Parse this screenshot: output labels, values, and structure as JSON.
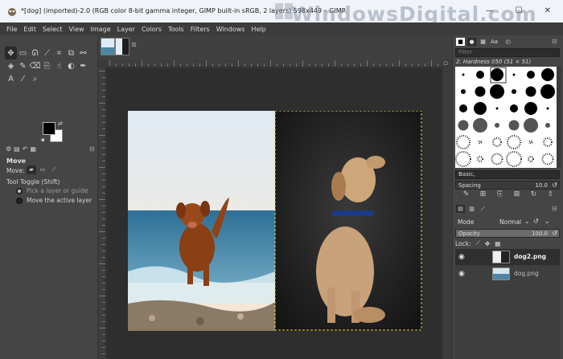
{
  "window": {
    "title": "*[dog] (imported)-2.0 (RGB color 8-bit gamma integer, GIMP built-in sRGB, 2 layers) 598x449 – GIMP",
    "watermark": "WindowsDigital.com",
    "controls": {
      "minimize": "—",
      "maximize": "☐",
      "close": "✕"
    }
  },
  "menu": [
    "File",
    "Edit",
    "Select",
    "View",
    "Image",
    "Layer",
    "Colors",
    "Tools",
    "Filters",
    "Windows",
    "Help"
  ],
  "toolbox": {
    "tools": [
      {
        "icon": "move-icon",
        "glyph": "✥"
      },
      {
        "icon": "rect-select-icon",
        "glyph": "▭"
      },
      {
        "icon": "lasso-icon",
        "glyph": "ᘏ"
      },
      {
        "icon": "fuzzy-select-icon",
        "glyph": "⟋"
      },
      {
        "icon": "crop-icon",
        "glyph": "⌗"
      },
      {
        "icon": "unified-transform-icon",
        "glyph": "⧉"
      },
      {
        "icon": "warp-icon",
        "glyph": "⚯"
      },
      {
        "icon": "bucket-fill-icon",
        "glyph": "◈"
      },
      {
        "icon": "paintbrush-icon",
        "glyph": "✎"
      },
      {
        "icon": "eraser-icon",
        "glyph": "⌫"
      },
      {
        "icon": "clone-icon",
        "glyph": "⎘"
      },
      {
        "icon": "smudge-icon",
        "glyph": "☝"
      },
      {
        "icon": "dodge-burn-icon",
        "glyph": "◐"
      },
      {
        "icon": "path-icon",
        "glyph": "✒"
      },
      {
        "icon": "text-tool-icon",
        "glyph": "A"
      },
      {
        "icon": "color-picker-icon",
        "glyph": "⁄"
      },
      {
        "icon": "zoom-icon",
        "glyph": "⌕"
      }
    ],
    "fg_color": "#000000",
    "bg_color": "#ffffff"
  },
  "tool_options": {
    "title": "Move",
    "move_label": "Move:",
    "toggle_label": "Tool Toggle  (Shift)",
    "option_pick": "Pick a layer or guide",
    "option_active": "Move the active layer"
  },
  "brushes": {
    "filter_placeholder": "Filter",
    "current_brush": "2. Hardness 050 (51 × 51)",
    "tag": "Basic,",
    "spacing_label": "Spacing",
    "spacing_value": "10.0"
  },
  "layers": {
    "mode_label": "Mode",
    "mode_value": "Normal",
    "opacity_label": "Opacity",
    "opacity_value": "100.0",
    "opacity_fraction": 1.0,
    "lock_label": "Lock:",
    "items": [
      {
        "name": "dog2.png",
        "visible": true,
        "selected": true
      },
      {
        "name": "dog.png",
        "visible": true,
        "selected": false
      }
    ]
  }
}
